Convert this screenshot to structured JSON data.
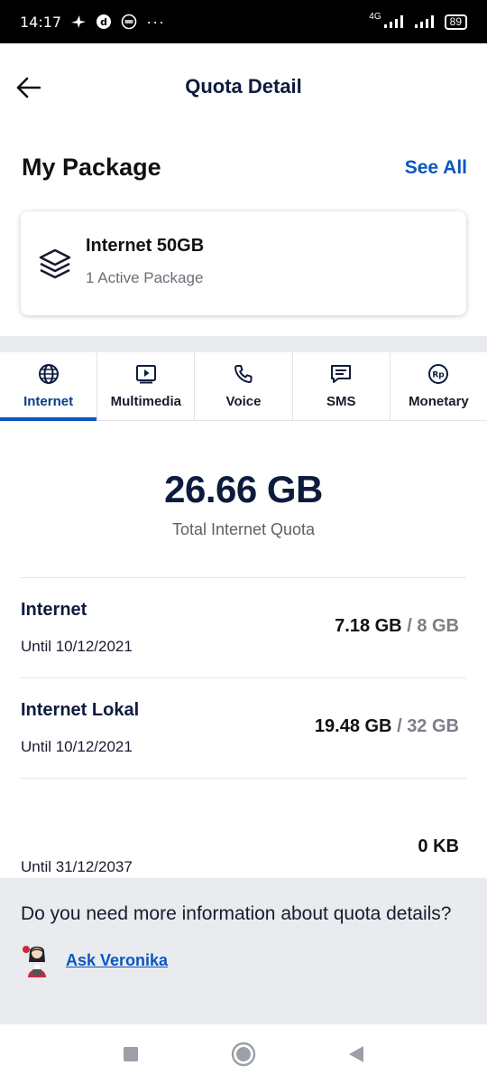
{
  "status_bar": {
    "time": "14:17",
    "network": "4G",
    "battery": "89",
    "more": "···"
  },
  "header": {
    "title": "Quota Detail"
  },
  "my_package": {
    "title": "My Package",
    "see_all": "See All",
    "card": {
      "name": "Internet 50GB",
      "subtitle": "1 Active Package",
      "icon": "layers-icon"
    }
  },
  "tabs": [
    {
      "label": "Internet",
      "icon": "globe-icon",
      "active": true
    },
    {
      "label": "Multimedia",
      "icon": "play-icon",
      "active": false
    },
    {
      "label": "Voice",
      "icon": "phone-icon",
      "active": false
    },
    {
      "label": "SMS",
      "icon": "message-icon",
      "active": false
    },
    {
      "label": "Monetary",
      "icon": "rupiah-icon",
      "active": false
    }
  ],
  "total": {
    "value": "26.66 GB",
    "label": "Total Internet Quota"
  },
  "quotas": [
    {
      "name": "Internet",
      "until": "Until 10/12/2021",
      "remaining": "7.18 GB",
      "separator": "/",
      "total": "8 GB"
    },
    {
      "name": "Internet Lokal",
      "until": "Until 10/12/2021",
      "remaining": "19.48 GB",
      "separator": "/",
      "total": "32 GB"
    },
    {
      "name": "",
      "until": "Until 31/12/2037",
      "remaining": "0 KB"
    }
  ],
  "help": {
    "text": "Do you need more information about quota details?",
    "link": "Ask Veronika"
  },
  "colors": {
    "primary": "#0a57c2",
    "title": "#0d1b3e",
    "band": "#e9ebee"
  }
}
